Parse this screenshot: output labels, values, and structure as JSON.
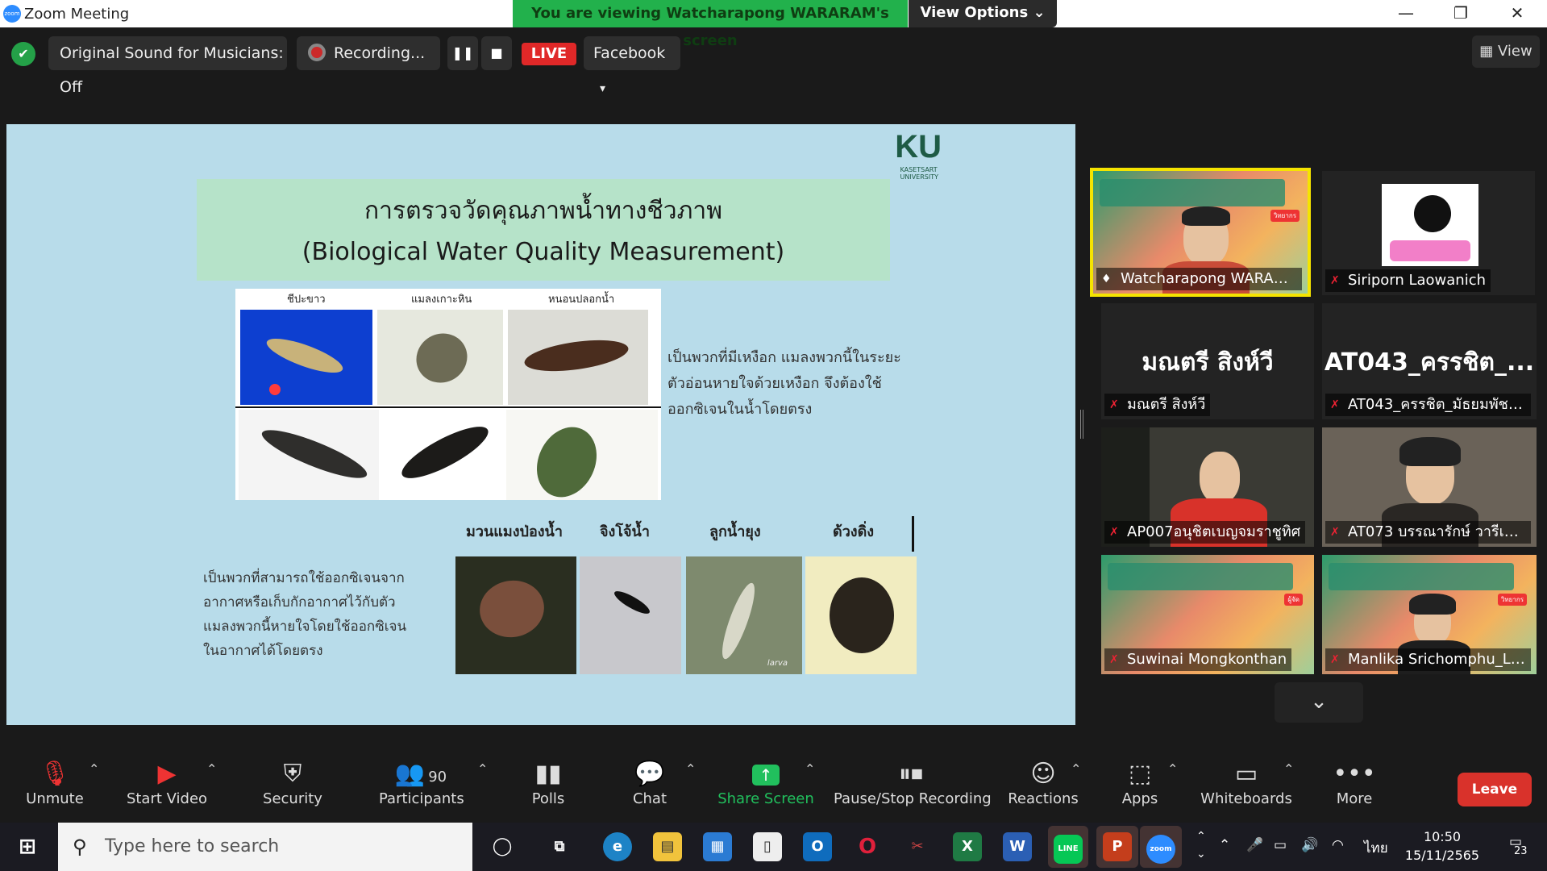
{
  "window": {
    "title": "Zoom Meeting",
    "viewing_banner": "You are viewing Watcharapong WARARAM's screen",
    "view_options": "View Options ⌄",
    "minimize": "—",
    "restore": "❐",
    "close": "✕"
  },
  "topbar": {
    "original_sound": "Original Sound for Musicians: Off",
    "recording": "Recording...",
    "pause_icon": "❚❚",
    "stop_icon": "■",
    "live": "LIVE",
    "platform": "Facebook",
    "platform_caret": "▾",
    "view": "View"
  },
  "slide": {
    "logo": "KU",
    "logo_sub1": "KASETSART",
    "logo_sub2": "UNIVERSITY",
    "title_th": "การตรวจวัดคุณภาพน้ำทางชีวภาพ",
    "title_en": "(Biological Water Quality Measurement)",
    "grid_headers": [
      "ชีปะขาว",
      "แมลงเกาะหิน",
      "หนอนปลอกน้ำ"
    ],
    "right_text": [
      "เป็นพวกที่มีเหงือก แมลงพวกนี้ในระยะ",
      "ตัวอ่อนหายใจด้วยเหงือก จึงต้องใช้",
      "ออกซิเจนในน้ำโดยตรง"
    ],
    "bottom_labels": [
      "มวนแมงป่องน้ำ",
      "จิงโจ้น้ำ",
      "ลูกน้ำยุง",
      "ด้วงดิ่ง"
    ],
    "left_text": [
      "เป็นพวกที่สามารถใช้ออกซิเจนจาก",
      "อากาศหรือเก็บกักอากาศไว้กับตัว",
      "แมลงพวกนี้หายใจโดยใช้ออกซิเจน",
      "ในอากาศได้โดยตรง"
    ],
    "larva_caption": "larva"
  },
  "participants": [
    {
      "name": "Watcharapong WARARAM",
      "type": "banner-video",
      "badge": "วิทยากร"
    },
    {
      "name": "Siriporn Laowanich",
      "type": "avatar"
    },
    {
      "name": "มณตรี สิงห์วี",
      "display": "มณตรี สิงห์วี",
      "type": "name"
    },
    {
      "name": "AT043_ครรชิต_มัธยมพัชรกิติ...",
      "display": "AT043_ครรชิต_...",
      "type": "name"
    },
    {
      "name": "AP007อนุชิตเบญจมราชูทิศ",
      "type": "video"
    },
    {
      "name": "AT073 บรรณารักษ์ วารีเชียงใ...",
      "type": "video"
    },
    {
      "name": "Suwinai Mongkonthan",
      "type": "banner-video",
      "badge": "ผู้จัด"
    },
    {
      "name": "Manlika Srichomphu_LERD",
      "type": "banner-video",
      "badge": "วิทยากร"
    }
  ],
  "more_participants": "⌄",
  "toolbar": {
    "unmute": "Unmute",
    "start_video": "Start Video",
    "security": "Security",
    "participants": "Participants",
    "participants_count": "90",
    "polls": "Polls",
    "chat": "Chat",
    "share_screen": "Share Screen",
    "pause_stop_recording": "Pause/Stop Recording",
    "reactions": "Reactions",
    "apps": "Apps",
    "whiteboards": "Whiteboards",
    "more": "More",
    "leave": "Leave"
  },
  "taskbar": {
    "search_placeholder": "Type here to search",
    "time": "10:50",
    "date": "15/11/2565",
    "lang": "ไทย",
    "notifications": "23",
    "apps": [
      "Cortana",
      "Task View",
      "Edge",
      "File Explorer",
      "Store",
      "Notepad",
      "Outlook",
      "Opera",
      "Snipping",
      "Excel",
      "Word",
      "LINE",
      "PowerPoint",
      "Zoom"
    ]
  },
  "colors": {
    "zoom_blue": "#2d8cff",
    "banner_green": "#22b14c",
    "live_red": "#e02828",
    "leave_red": "#d9322b",
    "active_speaker": "#f5e400",
    "share_green": "#21c05d"
  }
}
